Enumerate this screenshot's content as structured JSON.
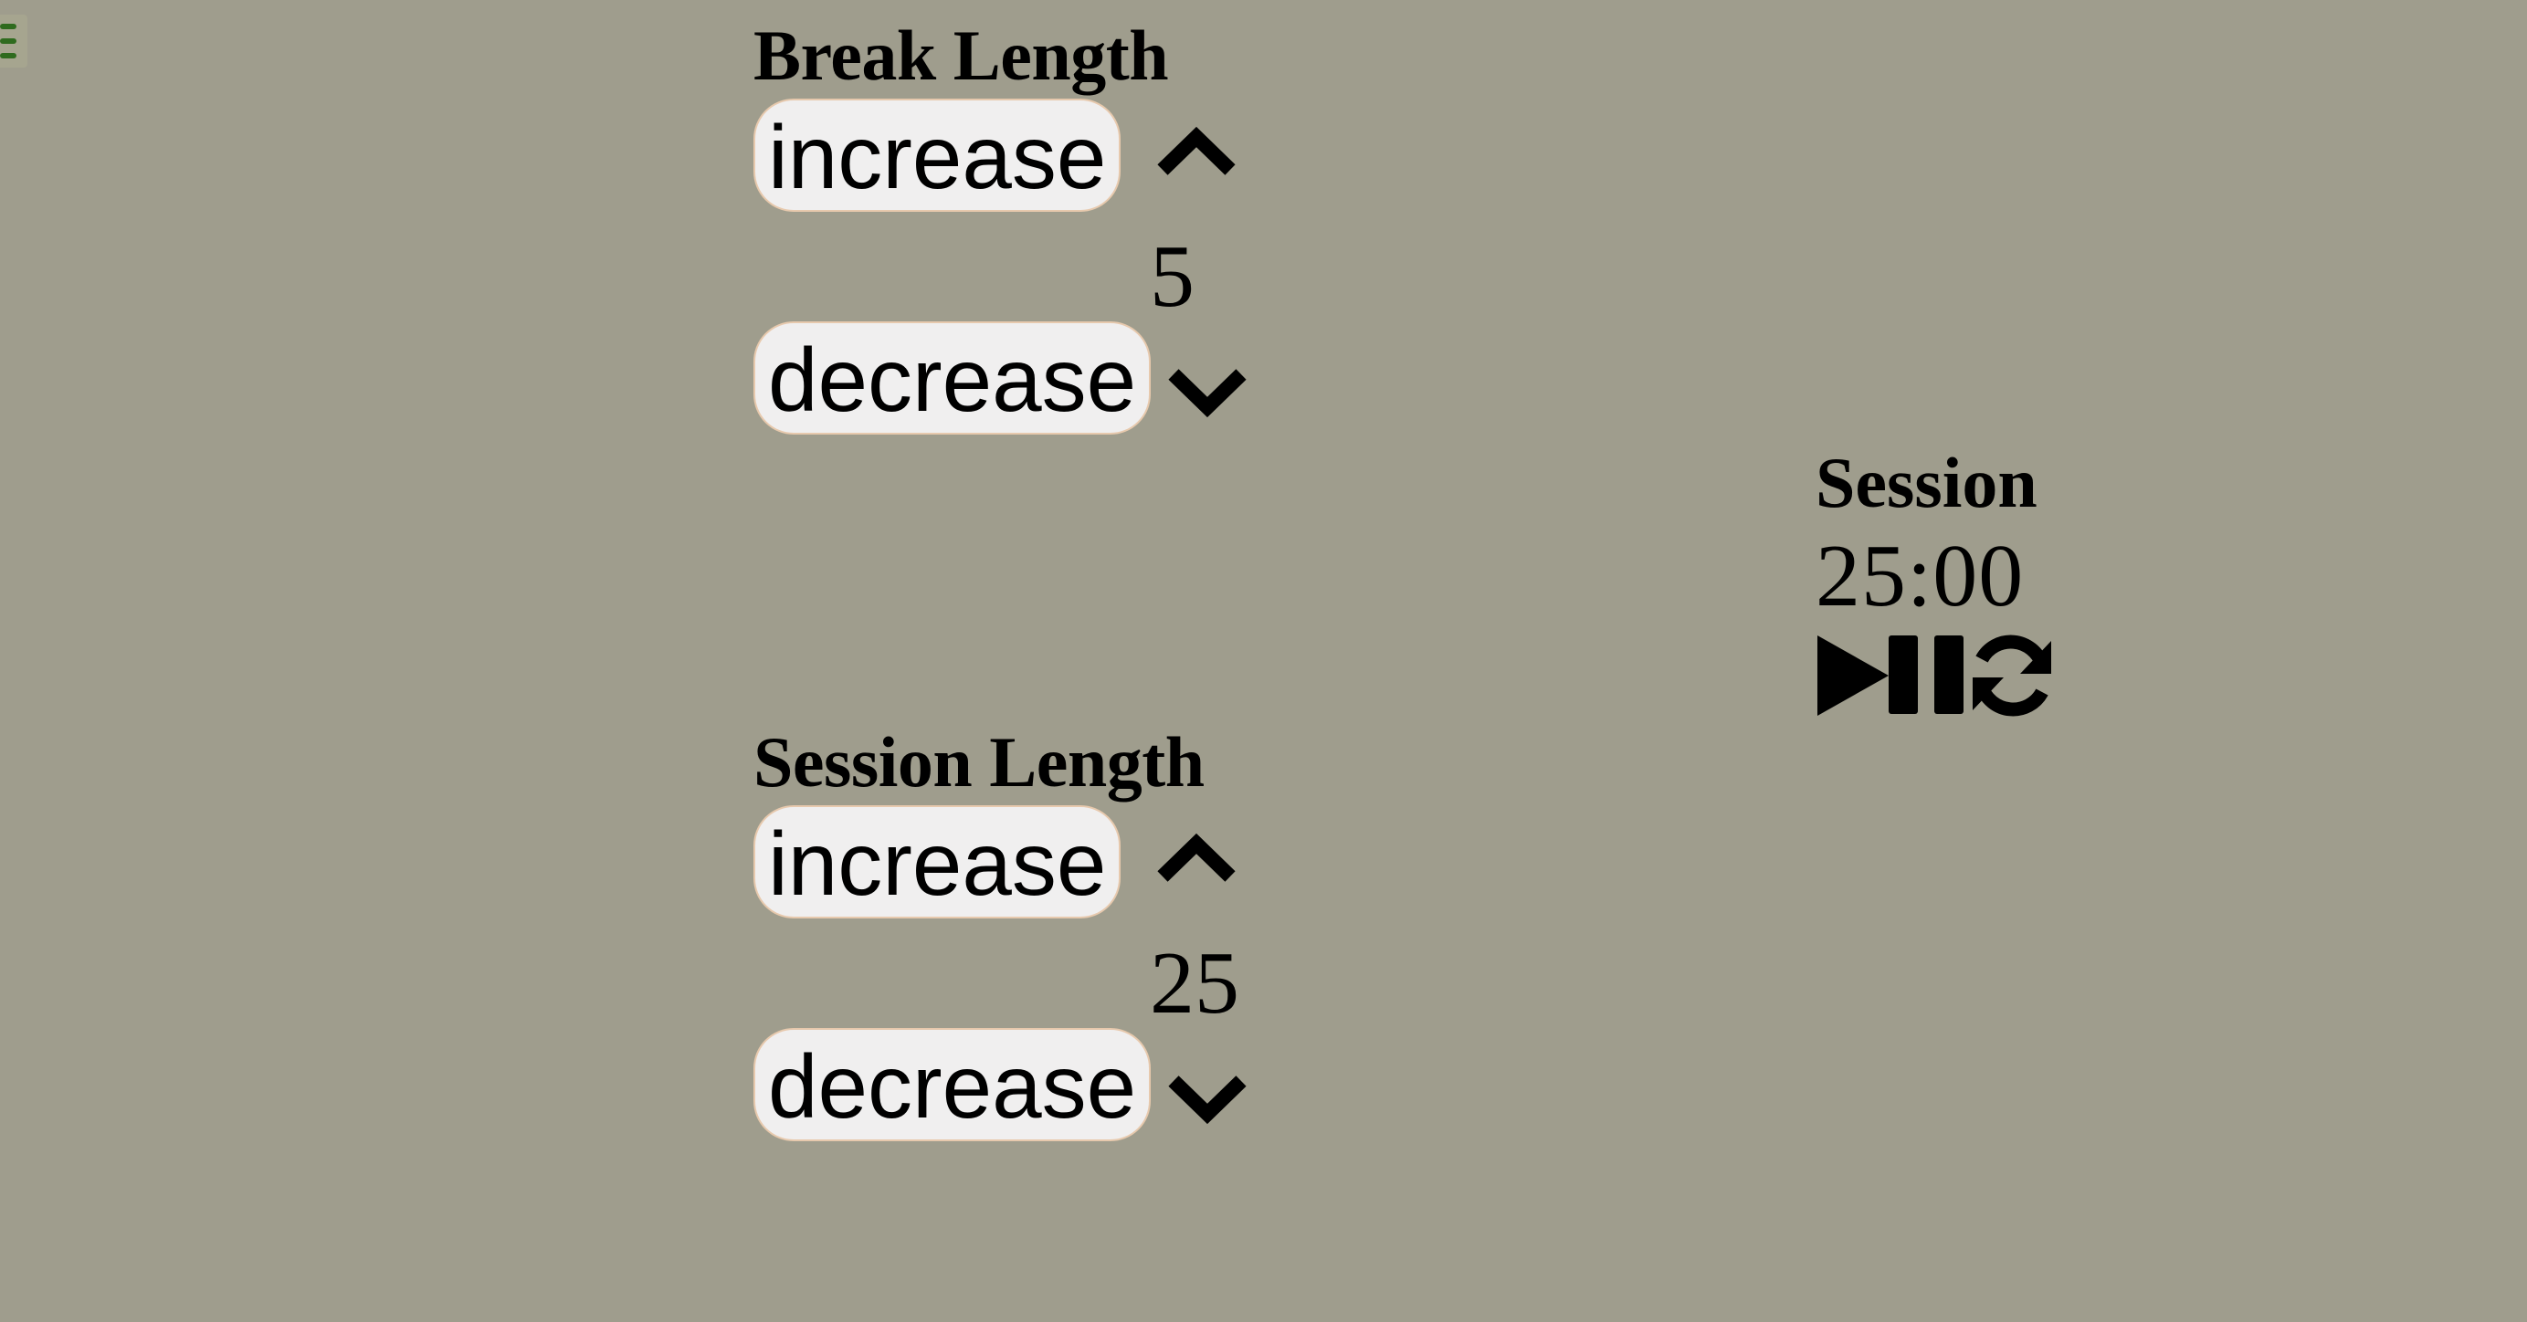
{
  "menu": {
    "icon": "hamburger-icon"
  },
  "break": {
    "title": "Break Length",
    "increase_label": "increase",
    "decrease_label": "decrease",
    "value": "5"
  },
  "session_length": {
    "title": "Session Length",
    "increase_label": "increase",
    "decrease_label": "decrease",
    "value": "25"
  },
  "timer": {
    "label": "Session",
    "time": "25:00",
    "icons": [
      "play-icon",
      "pause-icon",
      "refresh-icon"
    ]
  },
  "colors": {
    "background": "#9f9d8d",
    "button_bg": "#f0efef",
    "button_border": "#e7c9ad",
    "menu_icon": "#2f6b1e"
  }
}
